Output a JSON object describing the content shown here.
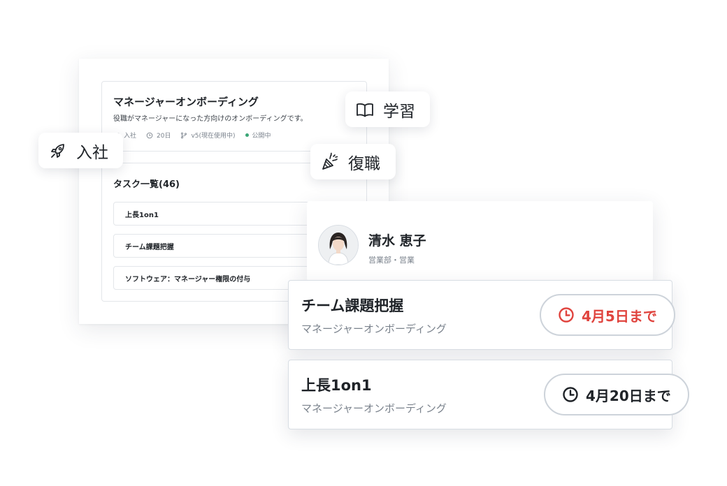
{
  "program": {
    "title": "マネージャーオンボーディング",
    "description": "役職がマネージャーになった方向けのオンボーディングです。",
    "meta": {
      "category": "入社",
      "days": "20日",
      "version": "v5(現在使用中)",
      "status": "公開中"
    },
    "task_heading": "タスク一覧(46)",
    "tasks": [
      {
        "label": "上長1on1"
      },
      {
        "label": "チーム課題把握"
      },
      {
        "label": "ソフトウェア：マネージャー権限の付与"
      }
    ]
  },
  "chips": {
    "learning": "学習",
    "joining": "入社",
    "return": "復職"
  },
  "person": {
    "name": "清水 恵子",
    "department": "営業部・営業"
  },
  "task_cards": [
    {
      "title": "チーム課題把握",
      "program": "マネージャーオンボーディング",
      "due": "4月5日まで",
      "due_color": "#e0443e"
    },
    {
      "title": "上長1on1",
      "program": "マネージャーオンボーディング",
      "due": "4月20日まで",
      "due_color": "#1f2328"
    }
  ],
  "colors": {
    "status_dot": "#3aa676",
    "overdue": "#e0443e"
  },
  "icons": {
    "learning": "book-icon",
    "joining": "rocket-icon",
    "return": "party-popper-icon",
    "due": "clock-icon"
  }
}
